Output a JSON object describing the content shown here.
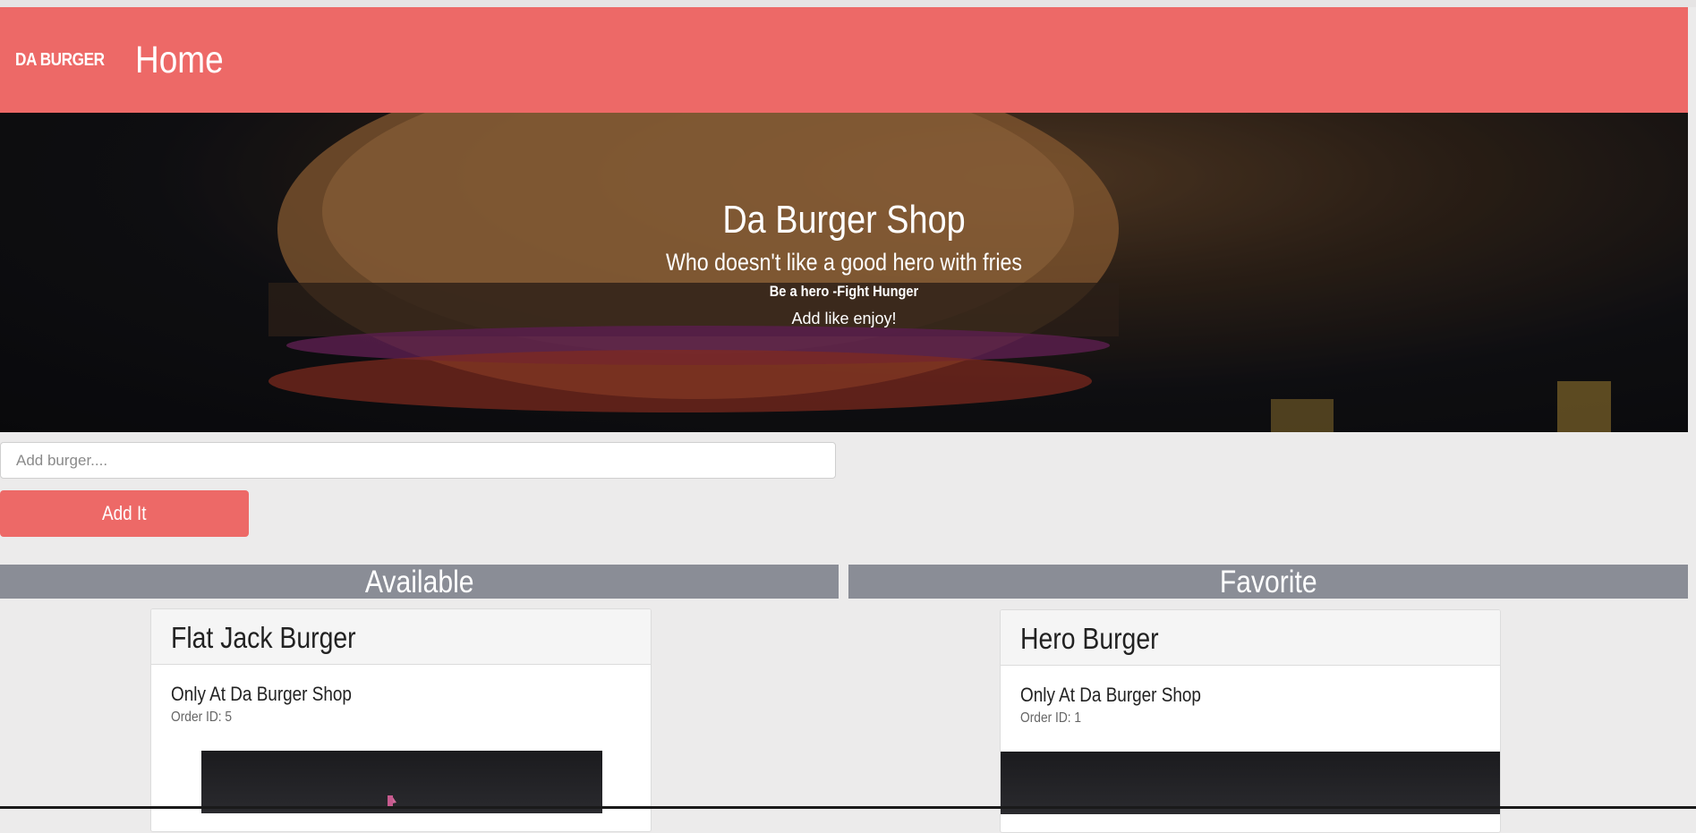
{
  "navbar": {
    "brand": "DA BURGER",
    "home_link": "Home"
  },
  "hero": {
    "title": "Da Burger Shop",
    "subtitle": "Who doesn't like a good hero with fries",
    "tagline": "Be a hero -Fight Hunger",
    "cta": "Add like enjoy!"
  },
  "form": {
    "placeholder": "Add burger....",
    "button_label": "Add It"
  },
  "columns": {
    "available": {
      "heading": "Available",
      "cards": [
        {
          "title": "Flat Jack Burger",
          "subtitle": "Only At Da Burger Shop",
          "order_id": "Order ID: 5"
        }
      ]
    },
    "favorite": {
      "heading": "Favorite",
      "cards": [
        {
          "title": "Hero Burger",
          "subtitle": "Only At Da Burger Shop",
          "order_id": "Order ID: 1"
        }
      ]
    }
  },
  "colors": {
    "accent": "#ed6967",
    "column_header": "#8a8d96",
    "background": "#ecebeb"
  }
}
